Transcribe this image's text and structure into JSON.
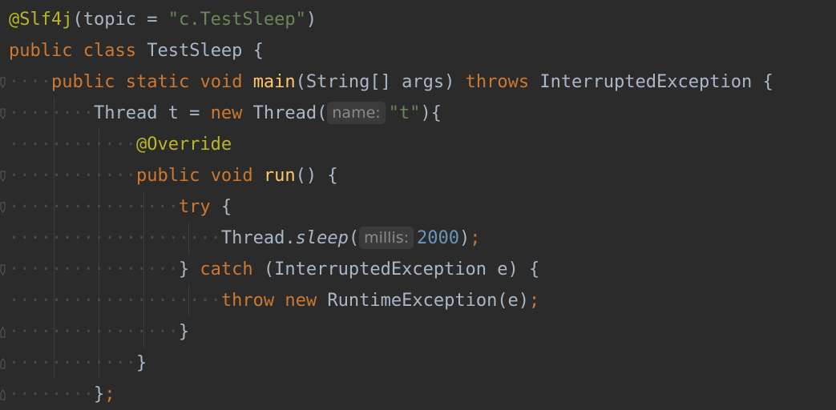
{
  "editor": {
    "theme_background": "#2b2b2b",
    "colors": {
      "annotation": "#bbb529",
      "keyword": "#cc7832",
      "string": "#6a8759",
      "function": "#ffc66d",
      "number": "#6897bb",
      "text": "#a9b7c6",
      "hint_text": "#8a8a8a",
      "hint_background": "#3b3b3b"
    },
    "fold_icon": "fold-marker-icon",
    "lines": [
      {
        "annotation": "@Slf4j",
        "open_paren": "(topic = ",
        "string": "\"c.TestSleep\"",
        "close_paren": ")"
      },
      {
        "kw1": "public",
        "kw2": "class",
        "name": "TestSleep {"
      },
      {
        "kw1": "public",
        "kw2": "static",
        "kw3": "void",
        "method": "main",
        "params": "(String[] args) ",
        "throws": "throws",
        "rest": " InterruptedException {"
      },
      {
        "type": "Thread t = ",
        "kw_new": "new",
        "ctor": " Thread(",
        "hint": "name:",
        "string": "\"t\"",
        "close": "){"
      },
      {
        "annotation": "@Override"
      },
      {
        "kw1": "public",
        "kw2": "void",
        "method": "run",
        "rest": "() {"
      },
      {
        "kw_try": "try",
        "rest": " {"
      },
      {
        "call": "Thread.",
        "method": "sleep",
        "open": "(",
        "hint": "millis:",
        "number": "2000",
        "close": ")",
        "semi": ";"
      },
      {
        "brace": "} ",
        "kw_catch": "catch",
        "rest": " (InterruptedException e) {"
      },
      {
        "kw_throw": "throw",
        "kw_new": "new",
        "rest": " RuntimeException(e)",
        "semi": ";"
      },
      {
        "brace": "}"
      },
      {
        "brace": "}"
      },
      {
        "brace": "}",
        "semi": ";"
      }
    ]
  }
}
